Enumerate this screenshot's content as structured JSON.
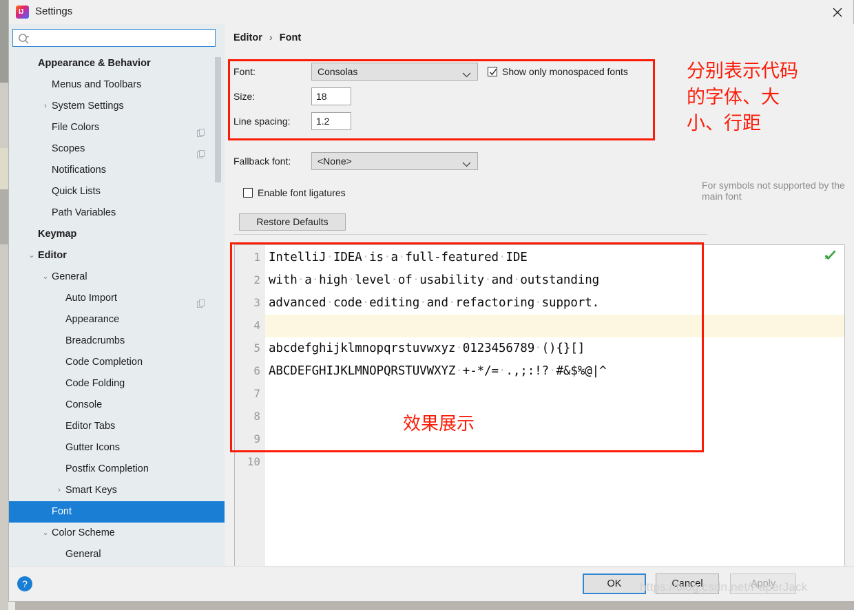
{
  "window": {
    "title": "Settings",
    "close_icon": "close-icon",
    "app_icon": "intellij-idea-logo"
  },
  "search": {
    "value": "",
    "placeholder": "",
    "icon": "search-icon"
  },
  "sidebar": {
    "items": [
      {
        "label": "Appearance & Behavior",
        "level": 0,
        "bold": true,
        "arrow": "",
        "copy": false,
        "selected": false
      },
      {
        "label": "Menus and Toolbars",
        "level": 1,
        "bold": false,
        "arrow": "",
        "copy": false,
        "selected": false
      },
      {
        "label": "System Settings",
        "level": 1,
        "bold": false,
        "arrow": "›",
        "copy": false,
        "selected": false
      },
      {
        "label": "File Colors",
        "level": 1,
        "bold": false,
        "arrow": "",
        "copy": true,
        "selected": false
      },
      {
        "label": "Scopes",
        "level": 1,
        "bold": false,
        "arrow": "",
        "copy": true,
        "selected": false
      },
      {
        "label": "Notifications",
        "level": 1,
        "bold": false,
        "arrow": "",
        "copy": false,
        "selected": false
      },
      {
        "label": "Quick Lists",
        "level": 1,
        "bold": false,
        "arrow": "",
        "copy": false,
        "selected": false
      },
      {
        "label": "Path Variables",
        "level": 1,
        "bold": false,
        "arrow": "",
        "copy": false,
        "selected": false
      },
      {
        "label": "Keymap",
        "level": 0,
        "bold": true,
        "arrow": "",
        "copy": false,
        "selected": false
      },
      {
        "label": "Editor",
        "level": 0,
        "bold": true,
        "arrow": "⌄",
        "copy": false,
        "selected": false
      },
      {
        "label": "General",
        "level": 1,
        "bold": false,
        "arrow": "⌄",
        "copy": false,
        "selected": false
      },
      {
        "label": "Auto Import",
        "level": 2,
        "bold": false,
        "arrow": "",
        "copy": true,
        "selected": false
      },
      {
        "label": "Appearance",
        "level": 2,
        "bold": false,
        "arrow": "",
        "copy": false,
        "selected": false
      },
      {
        "label": "Breadcrumbs",
        "level": 2,
        "bold": false,
        "arrow": "",
        "copy": false,
        "selected": false
      },
      {
        "label": "Code Completion",
        "level": 2,
        "bold": false,
        "arrow": "",
        "copy": false,
        "selected": false
      },
      {
        "label": "Code Folding",
        "level": 2,
        "bold": false,
        "arrow": "",
        "copy": false,
        "selected": false
      },
      {
        "label": "Console",
        "level": 2,
        "bold": false,
        "arrow": "",
        "copy": false,
        "selected": false
      },
      {
        "label": "Editor Tabs",
        "level": 2,
        "bold": false,
        "arrow": "",
        "copy": false,
        "selected": false
      },
      {
        "label": "Gutter Icons",
        "level": 2,
        "bold": false,
        "arrow": "",
        "copy": false,
        "selected": false
      },
      {
        "label": "Postfix Completion",
        "level": 2,
        "bold": false,
        "arrow": "",
        "copy": false,
        "selected": false
      },
      {
        "label": "Smart Keys",
        "level": 2,
        "bold": false,
        "arrow": "›",
        "copy": false,
        "selected": false
      },
      {
        "label": "Font",
        "level": 1,
        "bold": false,
        "arrow": "",
        "copy": false,
        "selected": true
      },
      {
        "label": "Color Scheme",
        "level": 1,
        "bold": false,
        "arrow": "⌄",
        "copy": false,
        "selected": false
      },
      {
        "label": "General",
        "level": 2,
        "bold": false,
        "arrow": "",
        "copy": false,
        "selected": false
      }
    ]
  },
  "breadcrumb": {
    "parent": "Editor",
    "separator": "›",
    "current": "Font"
  },
  "form": {
    "font_label": "Font:",
    "font_value": "Consolas",
    "size_label": "Size:",
    "size_value": "18",
    "line_spacing_label": "Line spacing:",
    "line_spacing_value": "1.2",
    "monospaced_label": "Show only monospaced fonts",
    "monospaced_checked": true,
    "fallback_label": "Fallback font:",
    "fallback_value": "<None>",
    "fallback_hint": "For symbols not supported by the main font",
    "ligatures_label": "Enable font ligatures",
    "ligatures_checked": false,
    "restore_defaults_label": "Restore Defaults"
  },
  "preview": {
    "line_numbers": [
      "1",
      "2",
      "3",
      "4",
      "5",
      "6",
      "7",
      "8",
      "9",
      "10"
    ],
    "highlighted_line": 4,
    "lines": [
      "IntelliJ IDEA is a full-featured IDE",
      "with a high level of usability and outstanding",
      "advanced code editing and refactoring support.",
      "",
      "abcdefghijklmnopqrstuvwxyz 0123456789 (){}[]",
      "ABCDEFGHIJKLMNOPQRSTUVWXYZ +-*/= .,;:!? #&$%@|^",
      "",
      "",
      "",
      ""
    ],
    "inspection_icon": "inspection-checkmark-icon"
  },
  "annotations": {
    "note_top": "分别表示代码\n的字体、大\n小、行距",
    "note_top_lines": [
      "分别表示代码",
      "的字体、大",
      "小、行距"
    ],
    "note_preview": "效果展示",
    "color": "#fb1c08"
  },
  "footer": {
    "help_icon": "help-question-icon",
    "ok_label": "OK",
    "cancel_label": "Cancel",
    "apply_label": "Apply",
    "watermark": "https://blog.csdn.net/PaperJack"
  },
  "colors": {
    "accent": "#1a7fd4",
    "annotation_red": "#fb1c08",
    "selection_blue": "#1a7fd4",
    "caret_row": "#fdf7e2"
  }
}
